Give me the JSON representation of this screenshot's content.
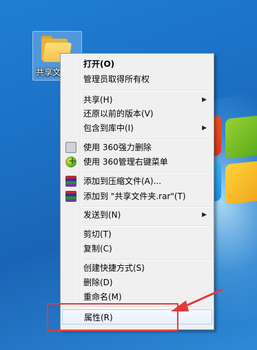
{
  "desktop": {
    "folder": {
      "label": "共享文件夹",
      "icon": "folder-icon"
    }
  },
  "context_menu": {
    "items": [
      {
        "label": "打开(O)",
        "bold": true
      },
      {
        "label": "管理员取得所有权"
      },
      {
        "label": "共享(H)",
        "submenu": true
      },
      {
        "label": "还原以前的版本(V)"
      },
      {
        "label": "包含到库中(I)",
        "submenu": true
      },
      {
        "label": "使用 360强力删除",
        "icon": "drive-icon"
      },
      {
        "label": "使用 360管理右键菜单",
        "icon": "360-icon"
      },
      {
        "label": "添加到压缩文件(A)...",
        "icon": "winrar-icon"
      },
      {
        "label": "添加到 \"共享文件夹.rar\"(T)",
        "icon": "winrar-icon"
      },
      {
        "label": "发送到(N)",
        "submenu": true
      },
      {
        "label": "剪切(T)"
      },
      {
        "label": "复制(C)"
      },
      {
        "label": "创建快捷方式(S)"
      },
      {
        "label": "删除(D)"
      },
      {
        "label": "重命名(M)"
      },
      {
        "label": "属性(R)",
        "highlighted": true
      }
    ],
    "submenu_arrow": "▶"
  },
  "annotation": {
    "box_color": "#e23b3b",
    "arrow_color": "#e23b3b"
  }
}
